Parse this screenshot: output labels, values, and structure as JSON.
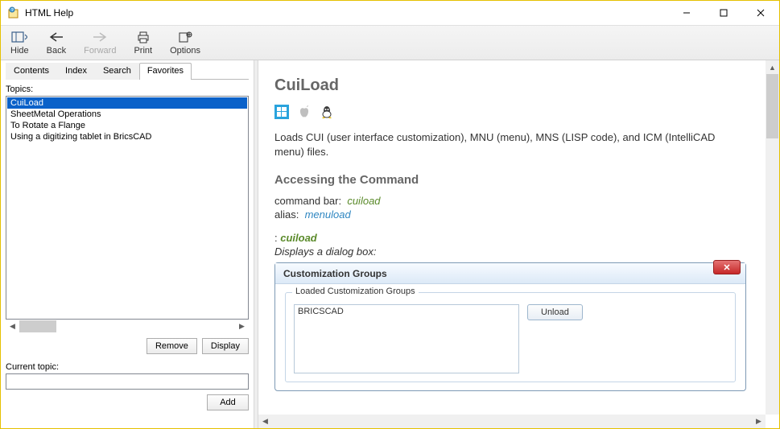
{
  "window": {
    "title": "HTML Help"
  },
  "toolbar": {
    "hide": "Hide",
    "back": "Back",
    "forward": "Forward",
    "print": "Print",
    "options": "Options"
  },
  "tabs": {
    "contents": "Contents",
    "index": "Index",
    "search": "Search",
    "favorites": "Favorites"
  },
  "left": {
    "topics_label": "Topics:",
    "items": [
      "CuiLoad",
      "SheetMetal Operations",
      "To Rotate a Flange",
      "Using a digitizing tablet in BricsCAD"
    ],
    "remove": "Remove",
    "display": "Display",
    "current_label": "Current topic:",
    "current_value": "",
    "add": "Add"
  },
  "content": {
    "title": "CuiLoad",
    "description": "Loads CUI (user interface customization), MNU (menu), MNS (LISP code), and ICM (IntelliCAD menu) files.",
    "h2": "Accessing the Command",
    "cmdbar_label": "command bar:",
    "cmdbar_value": "cuiload",
    "alias_label": "alias:",
    "alias_value": "menuload",
    "prompt": "cuiload",
    "displays": "Displays a dialog box:",
    "dialog": {
      "title": "Customization Groups",
      "group_label": "Loaded Customization Groups",
      "entry": "BRICSCAD",
      "unload": "Unload"
    }
  }
}
